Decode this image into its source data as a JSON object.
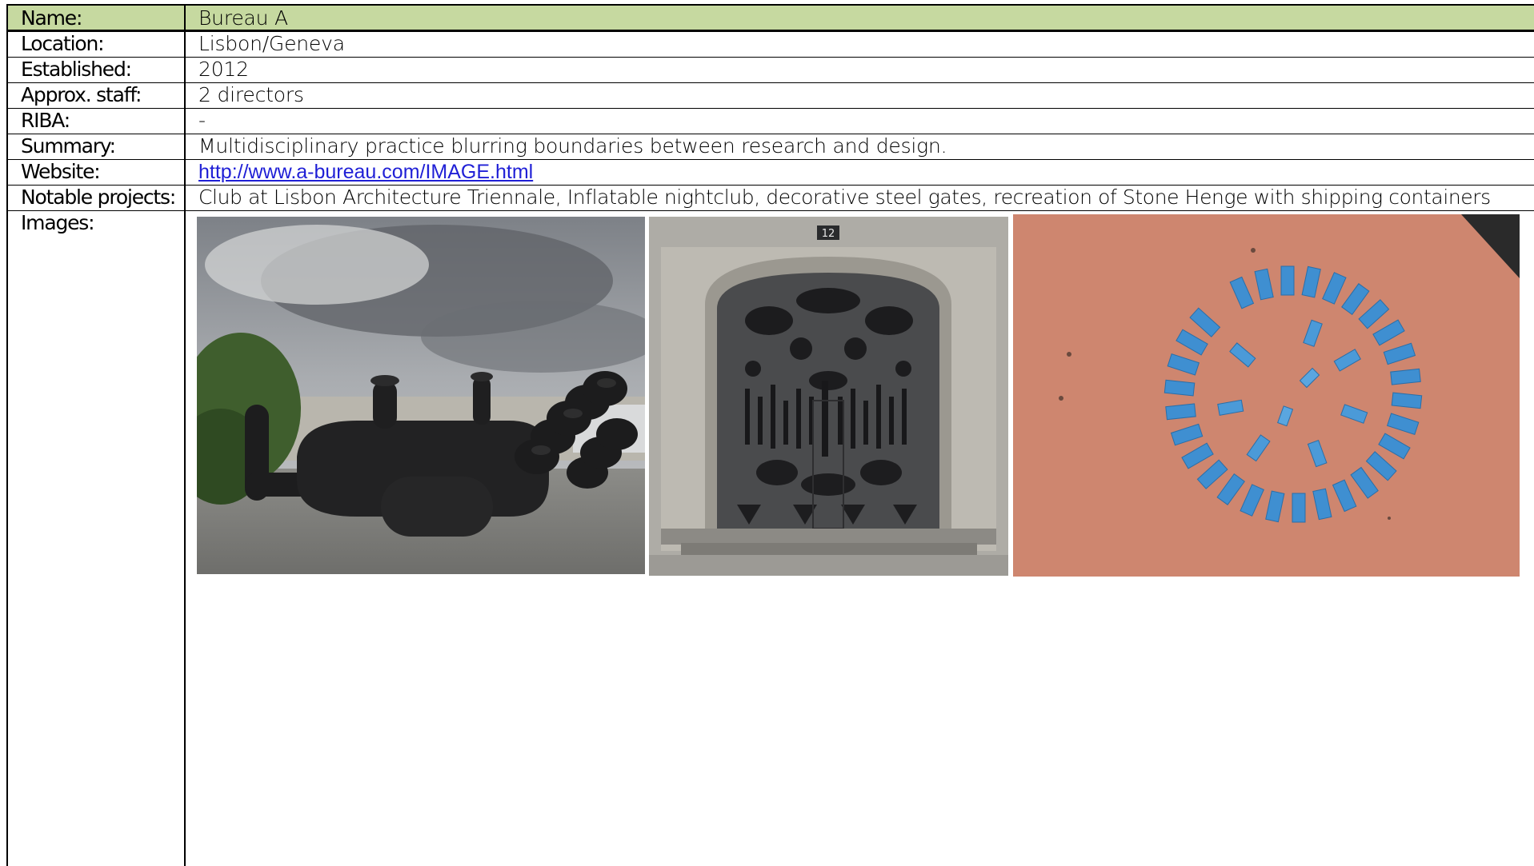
{
  "rows": [
    {
      "label": "Name:",
      "value": "Bureau A"
    },
    {
      "label": "Location:",
      "value": "Lisbon/Geneva"
    },
    {
      "label": "Established:",
      "value": "2012"
    },
    {
      "label": "Approx. staff:",
      "value": "2 directors"
    },
    {
      "label": "RIBA:",
      "value": "-"
    },
    {
      "label": "Summary:",
      "value": "Multidisciplinary practice blurring boundaries between research and design."
    },
    {
      "label": "Website:",
      "value": "http://www.a-bureau.com/IMAGE.html"
    },
    {
      "label": "Notable projects:",
      "value": "Club at Lisbon Architecture Triennale, Inflatable nightclub, decorative steel gates, recreation of Stone Henge with shipping containers"
    },
    {
      "label": "Images:"
    }
  ],
  "images": {
    "door_number": "12"
  },
  "colors": {
    "header_fill": "#c6d9a0",
    "link": "#1f1fd6",
    "grid": "#000000"
  }
}
